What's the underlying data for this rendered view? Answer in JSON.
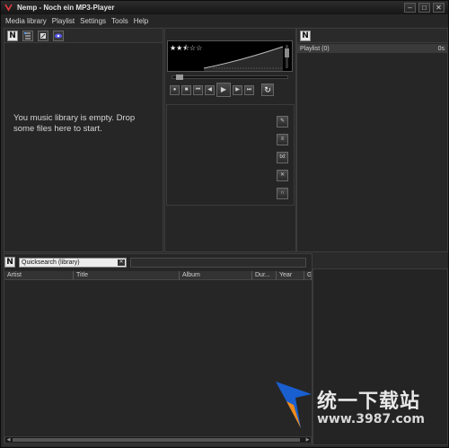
{
  "window": {
    "title": "Nemp - Noch ein MP3-Player"
  },
  "menu": [
    "Media library",
    "Playlist",
    "Settings",
    "Tools",
    "Help"
  ],
  "library": {
    "empty_message": "You music library is empty. Drop some files here to start."
  },
  "player": {
    "rating": "★★⯪☆☆",
    "rating_value": 2.5,
    "progress_fraction": 0.05
  },
  "playlist": {
    "title": "Playlist (0)",
    "duration": "0s"
  },
  "quicksearch": {
    "value": "Quicksearch (library)"
  },
  "columns": [
    "Artist",
    "Title",
    "Album",
    "Dur...",
    "Year",
    "G"
  ],
  "watermark": {
    "text": "统一下载站",
    "url": "www.3987.com"
  },
  "colors": {
    "background": "#262626",
    "accent_blue": "#1a5fd0",
    "accent_orange": "#f08a1a"
  }
}
